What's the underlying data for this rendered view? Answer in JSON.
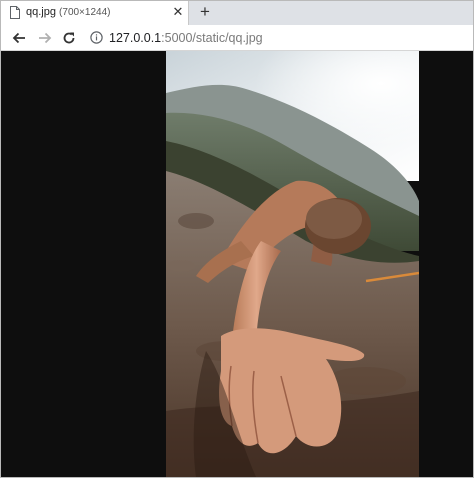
{
  "tab": {
    "title": "qq.jpg",
    "dimensions": "(700×1244)",
    "favicon": "file-icon"
  },
  "toolbar": {
    "url_host": "127.0.0.1",
    "url_path": ":5000/static/qq.jpg"
  },
  "image": {
    "description_icon": "photo"
  }
}
